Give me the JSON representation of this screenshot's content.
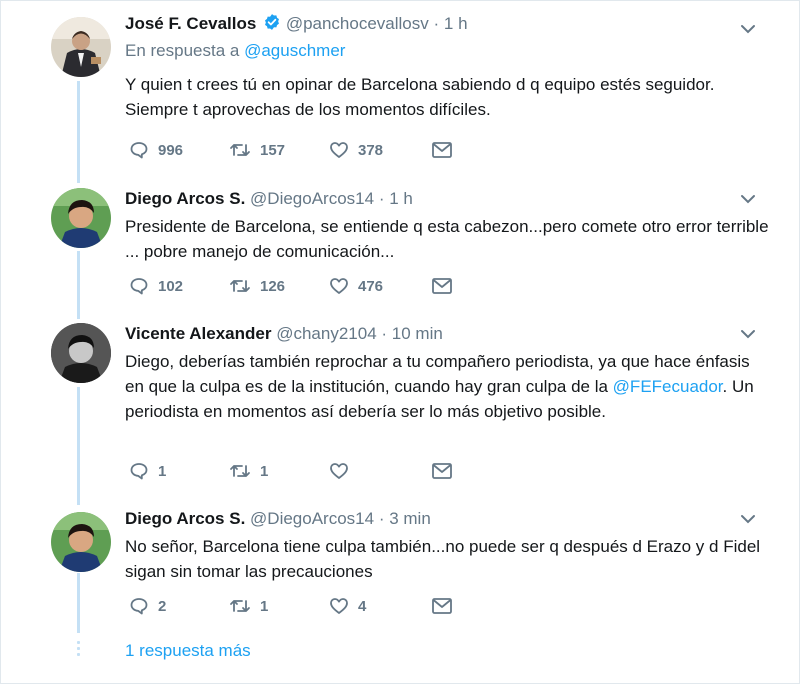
{
  "tweets": [
    {
      "name": "José F. Cevallos",
      "verified": true,
      "handle": "@panchocevallosv",
      "separator": "·",
      "time": "1 h",
      "reply_prefix": "En respuesta a ",
      "reply_mention": "@aguschmer",
      "text": "Y quien t crees tú en opinar de Barcelona sabiendo d q equipo estés seguidor. Siempre t aprovechas de los momentos difíciles.",
      "replies": "996",
      "retweets": "157",
      "likes": "378"
    },
    {
      "name": "Diego Arcos S.",
      "handle": "@DiegoArcos14",
      "separator": "·",
      "time": "1 h",
      "text": "Presidente de Barcelona, se entiende q esta cabezon...pero comete otro error terrible ... pobre manejo de comunicación...",
      "replies": "102",
      "retweets": "126",
      "likes": "476"
    },
    {
      "name": "Vicente Alexander",
      "handle": "@chany2104",
      "separator": "·",
      "time": "10 min",
      "text_before": "Diego, deberías también reprochar a tu compañero periodista, ya que hace énfasis en que la culpa es de la institución, cuando hay gran culpa de la ",
      "text_mention": "@FEFecuador",
      "text_after": ". Un periodista en momentos así debería ser lo más objetivo posible.",
      "replies": "1",
      "retweets": "1",
      "likes": ""
    },
    {
      "name": "Diego Arcos S.",
      "handle": "@DiegoArcos14",
      "separator": "·",
      "time": "3 min",
      "text": "No señor, Barcelona tiene culpa también...no puede ser q después d Erazo y d Fidel sigan sin  tomar las precauciones",
      "replies": "2",
      "retweets": "1",
      "likes": "4"
    }
  ],
  "more_replies": "1 respuesta más",
  "colors": {
    "accent": "#1da1f2",
    "secondary_text": "#657786",
    "thread_line": "#c4e0f5",
    "border": "#e1e8ed"
  },
  "icons": [
    "verified-badge-icon",
    "chevron-down-icon",
    "reply-icon",
    "retweet-icon",
    "like-icon",
    "direct-message-icon"
  ]
}
